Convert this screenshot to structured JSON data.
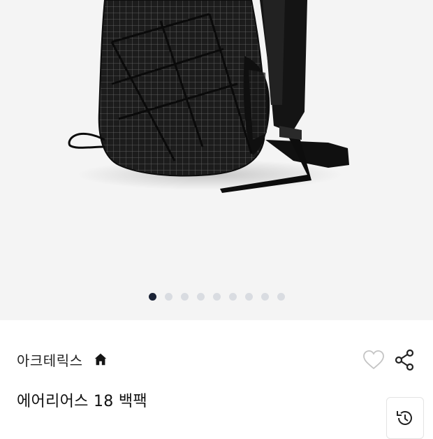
{
  "gallery": {
    "slide_count": 9,
    "active_index": 0
  },
  "brand": {
    "name": "아크테릭스",
    "home_icon": "home-icon"
  },
  "actions": {
    "wishlist_icon": "heart-icon",
    "share_icon": "share-icon"
  },
  "product": {
    "title": "에어리어스 18 백팩"
  },
  "floating": {
    "recent_icon": "history-icon"
  },
  "colors": {
    "hero_bg": "#f4f4f4",
    "dot_active": "#1b2336",
    "dot_inactive": "#d9dce1"
  }
}
